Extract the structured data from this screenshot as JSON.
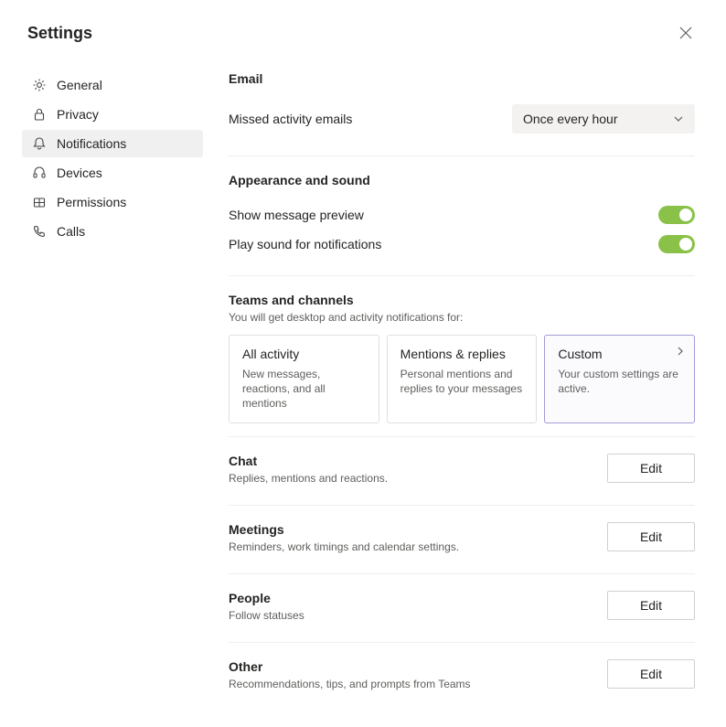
{
  "window_title": "Settings",
  "sidebar": {
    "items": [
      {
        "label": "General"
      },
      {
        "label": "Privacy"
      },
      {
        "label": "Notifications"
      },
      {
        "label": "Devices"
      },
      {
        "label": "Permissions"
      },
      {
        "label": "Calls"
      }
    ],
    "active_index": 2
  },
  "sections": {
    "email": {
      "title": "Email",
      "missed_label": "Missed activity emails",
      "missed_value": "Once every hour"
    },
    "appearance": {
      "title": "Appearance and sound",
      "preview_label": "Show message preview",
      "preview_on": true,
      "sound_label": "Play sound for notifications",
      "sound_on": true
    },
    "teams": {
      "title": "Teams and channels",
      "subtitle": "You will get desktop and activity notifications for:",
      "cards": [
        {
          "title": "All activity",
          "desc": "New messages, reactions, and all mentions"
        },
        {
          "title": "Mentions & replies",
          "desc": "Personal mentions and replies to your messages"
        },
        {
          "title": "Custom",
          "desc": "Your custom settings are active."
        }
      ],
      "selected_index": 2
    },
    "edit_rows": [
      {
        "title": "Chat",
        "desc": "Replies, mentions and reactions.",
        "button": "Edit"
      },
      {
        "title": "Meetings",
        "desc": "Reminders, work timings and calendar settings.",
        "button": "Edit"
      },
      {
        "title": "People",
        "desc": "Follow statuses",
        "button": "Edit"
      },
      {
        "title": "Other",
        "desc": "Recommendations, tips, and prompts from Teams",
        "button": "Edit"
      }
    ]
  }
}
